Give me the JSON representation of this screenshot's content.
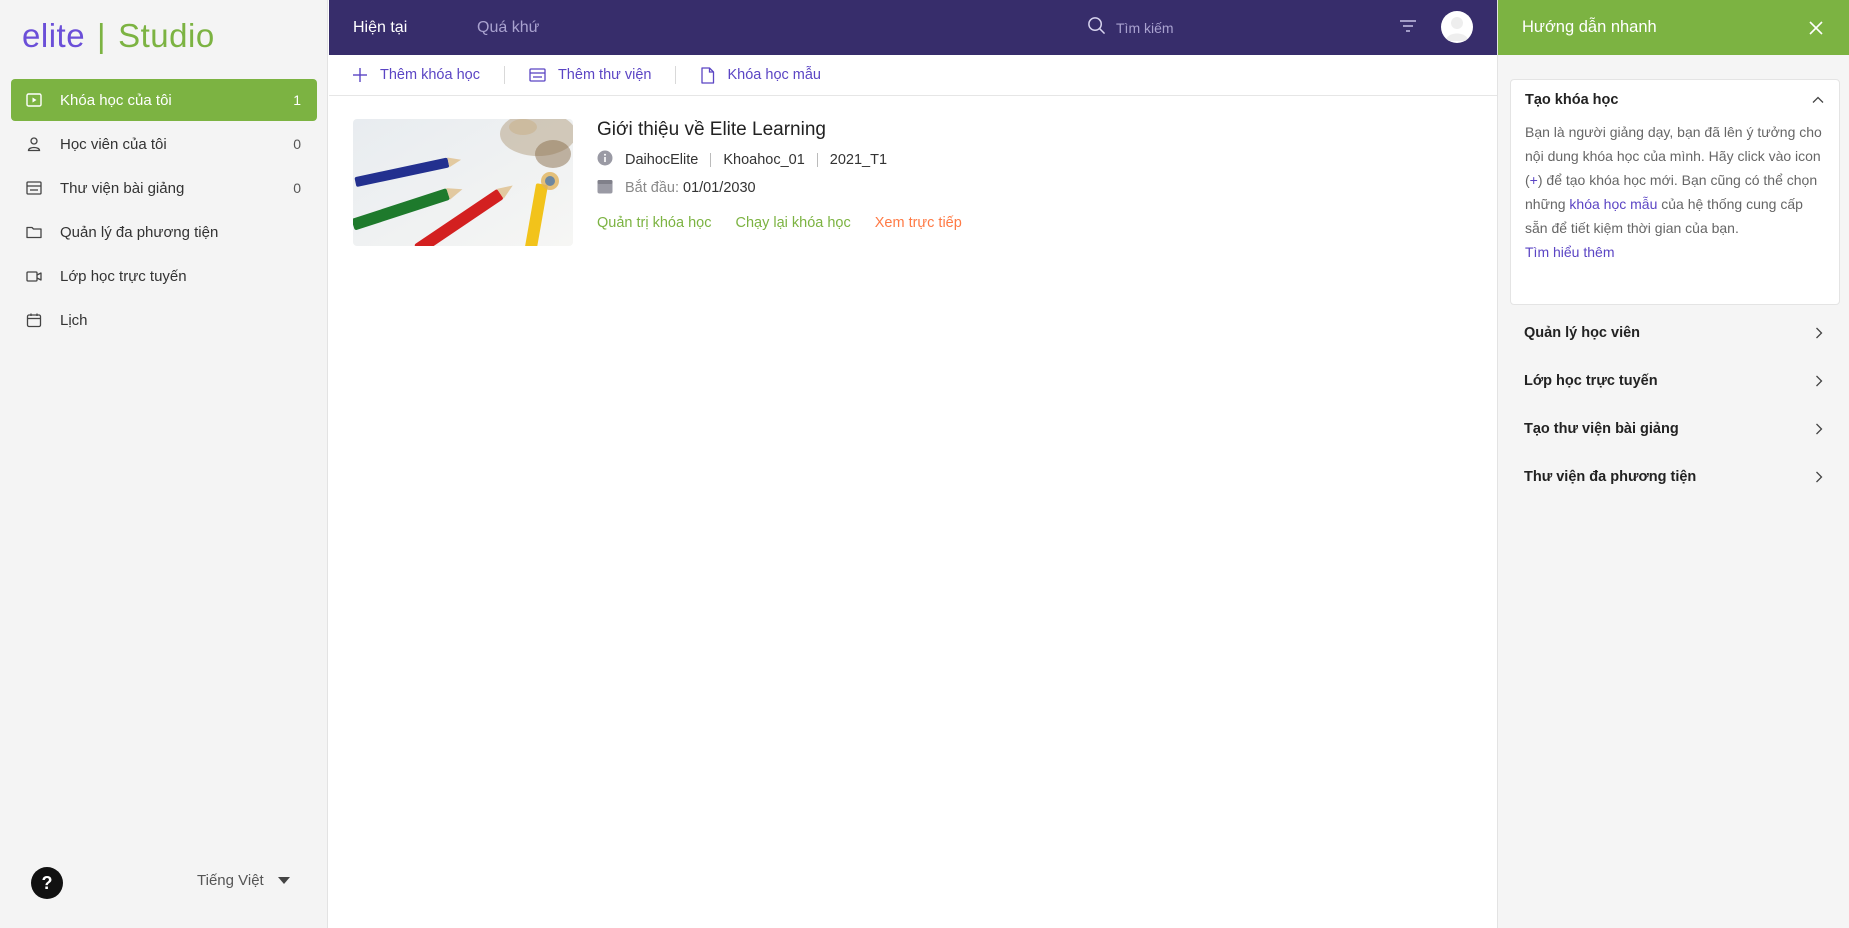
{
  "logo": {
    "e": "e",
    "lite": "lite",
    "sep": "|",
    "studio": "Studio"
  },
  "sidebar": {
    "items": [
      {
        "label": "Khóa học của tôi",
        "count": "1",
        "icon": "play-square-icon"
      },
      {
        "label": "Học viên của tôi",
        "count": "0",
        "icon": "user-icon"
      },
      {
        "label": "Thư viện bài giảng",
        "count": "0",
        "icon": "library-icon"
      },
      {
        "label": "Quản lý đa phương tiện",
        "count": "",
        "icon": "folder-icon"
      },
      {
        "label": "Lớp học trực tuyến",
        "count": "",
        "icon": "video-camera-icon"
      },
      {
        "label": "Lịch",
        "count": "",
        "icon": "calendar-icon"
      }
    ],
    "help": "?",
    "language": "Tiếng Việt"
  },
  "header": {
    "tabs": [
      {
        "label": "Hiện tại"
      },
      {
        "label": "Quá khứ"
      }
    ],
    "search_placeholder": "Tìm kiếm"
  },
  "toolbar": {
    "add_course": "Thêm khóa học",
    "add_library": "Thêm thư viện",
    "template_course": "Khóa học mẫu"
  },
  "course": {
    "title": "Giới thiệu về Elite Learning",
    "org": "DaihocElite",
    "code": "Khoahoc_01",
    "term": "2021_T1",
    "start_label": "Bắt đầu:",
    "start_date": "01/01/2030",
    "actions": {
      "manage": "Quản trị khóa học",
      "rerun": "Chạy lại khóa học",
      "preview": "Xem trực tiếp"
    }
  },
  "guide": {
    "title": "Hướng dẫn nhanh",
    "open_section": {
      "title": "Tạo khóa học",
      "text_1": "Bạn là người giảng dạy, bạn đã lên ý tưởng cho nội dung khóa học của mình. Hãy click vào icon (",
      "plus": "+",
      "text_2": ") để tạo khóa học mới. Bạn cũng có thể chọn những ",
      "link": "khóa học mẫu",
      "text_3": " của hệ thống cung cấp sẵn để tiết kiệm thời gian của bạn.",
      "more": "Tìm hiểu thêm"
    },
    "sections": [
      "Quản lý học viên",
      "Lớp học trực tuyến",
      "Tạo thư viện bài giảng",
      "Thư viện đa phương tiện"
    ]
  },
  "colors": {
    "brand_purple": "#372d6b",
    "accent_purple": "#5b45c4",
    "brand_green": "#7cb342",
    "orange": "#ff7a45"
  }
}
